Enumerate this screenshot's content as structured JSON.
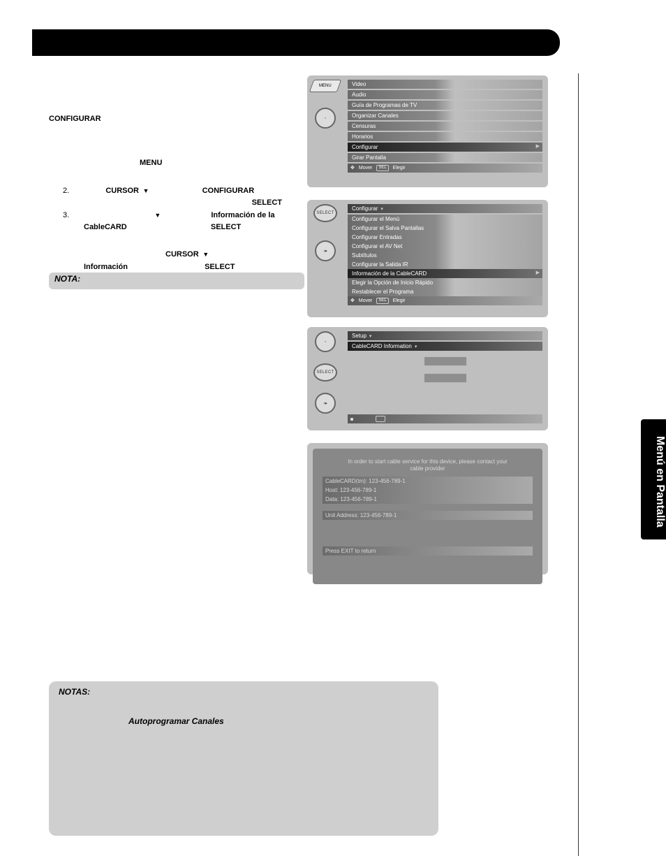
{
  "sideTab": "Menú en Pantalla",
  "steps": {
    "configurar": "CONFIGURAR",
    "menu": "MENU",
    "step2_num": "2.",
    "cursor": "CURSOR",
    "conf2": "CONFIGURAR",
    "select": "SELECT",
    "step3_num": "3.",
    "info_de_la": "Información de la",
    "cablecard": "CableCARD",
    "cursor2": "CURSOR",
    "informacion": "Información",
    "nota": "NOTA:"
  },
  "notas": {
    "title": "NOTAS:",
    "sub": "Autoprogramar Canales"
  },
  "remote": {
    "menu": "MENU",
    "select": "SELECT"
  },
  "panel1": {
    "items": [
      "Video",
      "Audio",
      "Guía de Programas de TV",
      "Organizar Canales",
      "Censuras",
      "Horarios",
      "Configurar",
      "Girar Pantalla"
    ],
    "highlight": "Configurar",
    "hint_move": "Mover",
    "hint_sel_box": "SEL",
    "hint_sel": "Elegir"
  },
  "panel2": {
    "header": "Configurar",
    "items": [
      "Configurar el Menú",
      "Configurar el Salva Pantallas",
      "Configurar Entradas",
      "Configurar el AV Net",
      "Subtítulos",
      "Configurar la Salida IR",
      "Información de la CableCARD",
      "Elegir la Opción de Inicio Rápido",
      "Restablecer el Programa"
    ],
    "highlight": "Información de la CableCARD",
    "hint_move": "Mover",
    "hint_sel_box": "SEL",
    "hint_sel": "Elegir"
  },
  "panel3": {
    "header": "Setup",
    "row": "CableCARD Information"
  },
  "panel4": {
    "intro": "In order to start cable service for this device, please contact your cable provider",
    "rows": [
      "CableCARD(tm):  123-456-789-1",
      "Host:  123-456-789-1",
      "Data:  123-456-789-1"
    ],
    "unit": "Unit Address:  123-456-789-1",
    "exit": "Press EXIT to return"
  }
}
